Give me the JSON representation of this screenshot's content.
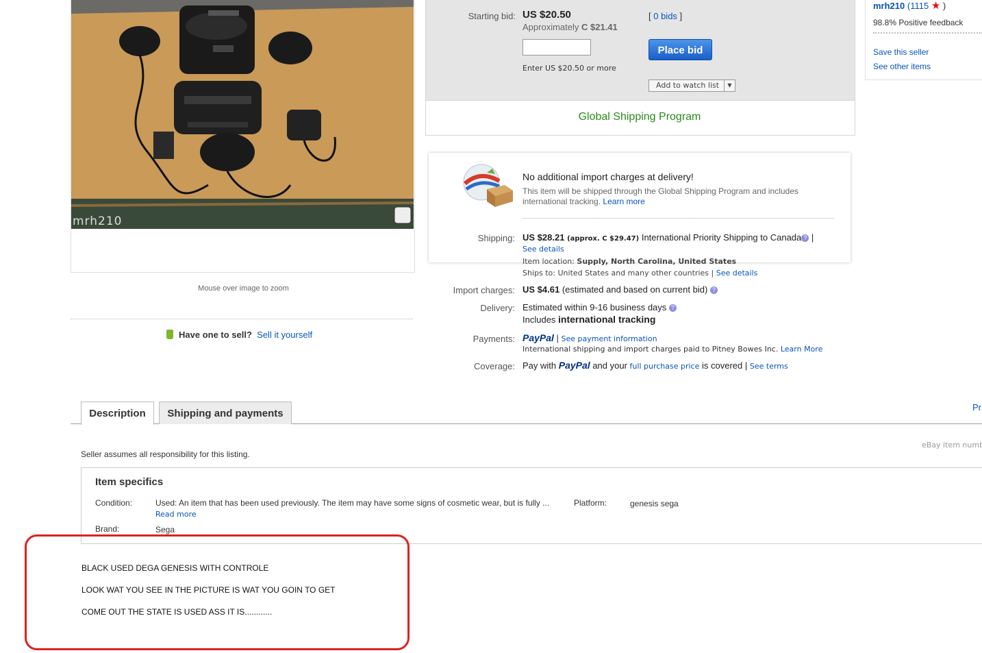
{
  "image": {
    "watermark": "mrh210",
    "zoom_hint": "Mouse over image to zoom"
  },
  "sell": {
    "prompt": "Have one to sell?",
    "link": "Sell it yourself"
  },
  "bid": {
    "starting_label": "Starting bid:",
    "price": "US $20.50",
    "approx_prefix": "Approximately",
    "approx_value": "C $21.41",
    "bids_count": "0 bids",
    "input_hint": "Enter US $20.50 or more",
    "place_bid": "Place bid",
    "watch_list": "Add to watch list"
  },
  "gsp_title": "Global Shipping Program",
  "import_card": {
    "headline": "No additional import charges at delivery!",
    "text": "This item will be shipped through the Global Shipping Program and includes international tracking.",
    "learn_more": "Learn more"
  },
  "shipping": {
    "label": "Shipping:",
    "price": "US $28.21",
    "approx": "(approx. C $29.47)",
    "service": "International Priority Shipping to Canada",
    "see_details": "See details",
    "item_location_label": "Item location:",
    "item_location": "Supply, North Carolina, United States",
    "ships_to_label": "Ships to:",
    "ships_to": "United States and many other countries",
    "ships_to_details": "See details"
  },
  "import_charges": {
    "label": "Import charges:",
    "value": "US $4.61",
    "note": "(estimated and based on current bid)"
  },
  "delivery": {
    "label": "Delivery:",
    "line1": "Estimated within 9-16 business days",
    "line2_prefix": "Includes",
    "line2_bold": "international tracking"
  },
  "payments": {
    "label": "Payments:",
    "paypal": "PayPal",
    "see_info": "See payment information",
    "note": "International shipping and import charges paid to Pitney Bowes Inc.",
    "learn_more": "Learn More"
  },
  "coverage": {
    "label": "Coverage:",
    "pay_with": "Pay with",
    "paypal": "PayPal",
    "and_your": "and your",
    "full_price": "full purchase price",
    "is_covered": "is covered |",
    "see_terms": "See terms"
  },
  "seller": {
    "name": "mrh210",
    "score_open": "(1115",
    "score_close": ")",
    "feedback": "98.8% Positive feedback",
    "save": "Save this seller",
    "see_other": "See other items"
  },
  "tabs": [
    {
      "label": "Description"
    },
    {
      "label": "Shipping and payments"
    }
  ],
  "pr_link": "Pr",
  "item_number": "eBay item numb",
  "seller_assumes": "Seller assumes all responsibility for this listing.",
  "specifics": {
    "title": "Item specifics",
    "condition_key": "Condition:",
    "condition_value": "Used: An item that has been used previously. The item may have some signs of cosmetic wear, but is fully ...",
    "read_more": "Read more",
    "brand_key": "Brand:",
    "brand_value": "Sega",
    "platform_key": "Platform:",
    "platform_value": "genesis sega"
  },
  "description": [
    "BLACK USED DEGA GENESIS WITH CONTROLE",
    "LOOK WAT YOU SEE IN THE PICTURE IS WAT YOU GOIN TO GET",
    "COME OUT THE STATE IS USED ASS IT IS............"
  ],
  "colors": {
    "gsp_green": "#2a8a1c",
    "link_blue": "#0654ba",
    "highlight_red": "#e02020",
    "bid_button": "#1a5fc9"
  }
}
